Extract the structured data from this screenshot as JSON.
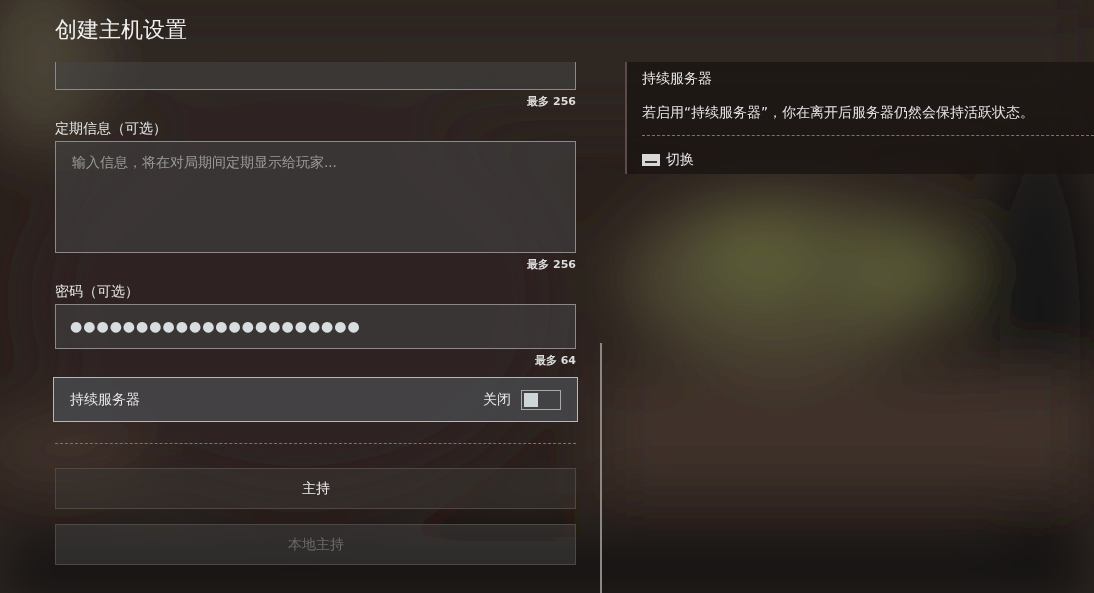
{
  "title": "创建主机设置",
  "form": {
    "fields": [
      {
        "kind": "input",
        "limit": "最多 256"
      },
      {
        "kind": "textarea",
        "label": "定期信息（可选）",
        "placeholder": "输入信息，将在对局期间定期显示给玩家...",
        "limit": "最多 256"
      },
      {
        "kind": "password",
        "label": "密码（可选）",
        "value": "●●●●●●●●●●●●●●●●●●●●●●",
        "limit": "最多 64"
      }
    ],
    "toggle": {
      "label": "持续服务器",
      "state_text": "关闭",
      "on": false
    },
    "buttons": [
      {
        "label": "主持",
        "disabled": false
      },
      {
        "label": "本地主持",
        "disabled": true
      }
    ]
  },
  "help": {
    "title": "持续服务器",
    "description": "若启用“持续服务器”，你在离开后服务器仍然会保持活跃状态。",
    "action": "切换"
  }
}
